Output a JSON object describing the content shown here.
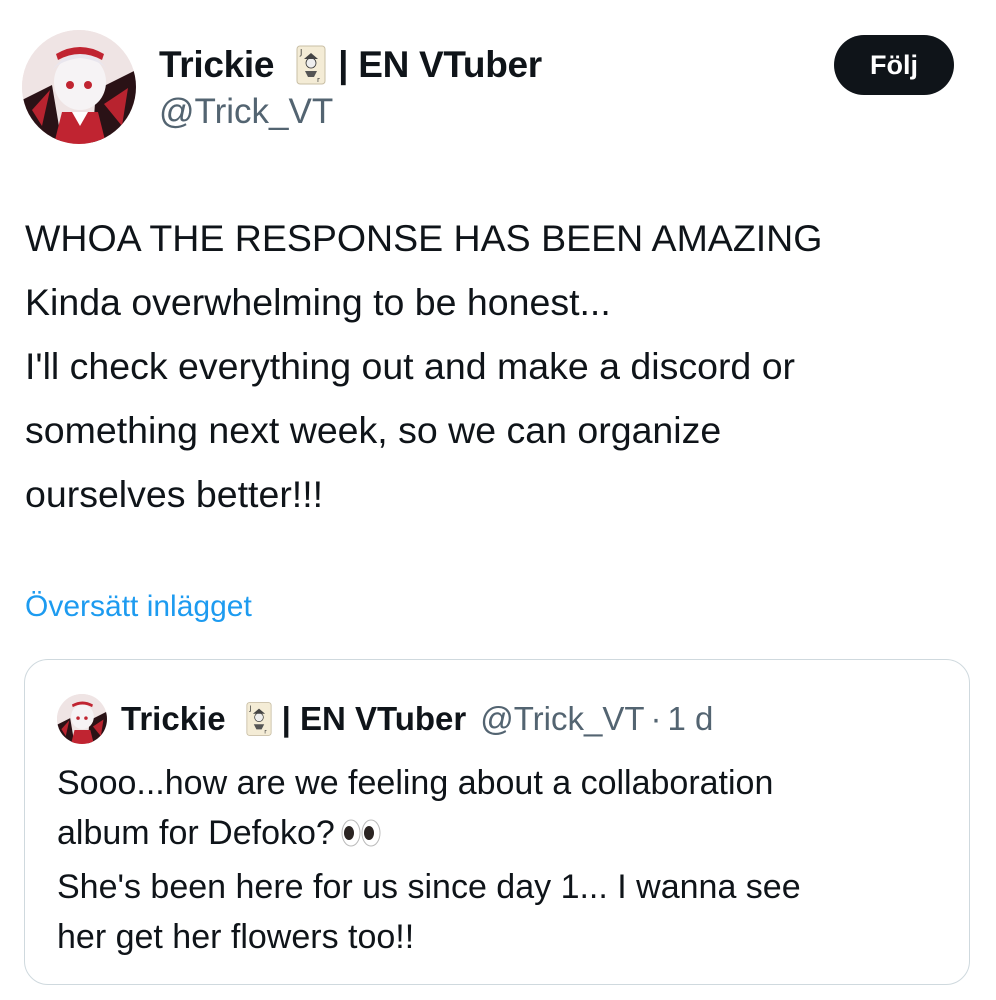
{
  "author": {
    "display_name": "Trickie",
    "name_suffix": "| EN VTuber",
    "handle": "@Trick_VT"
  },
  "follow_button": {
    "label": "Följ"
  },
  "tweet": {
    "lines": [
      "WHOA THE RESPONSE HAS BEEN AMAZING",
      "Kinda overwhelming to be honest...",
      "I'll check everything out and make a discord or",
      "something next week, so we can organize",
      "ourselves better!!!"
    ]
  },
  "translate_link": "Översätt inlägget",
  "quoted_tweet": {
    "display_name": "Trickie",
    "name_suffix": "| EN VTuber",
    "handle": "@Trick_VT",
    "separator": "·",
    "time": "1 d",
    "lines": [
      "Sooo...how are we feeling about a collaboration",
      "album for Defoko?",
      "She's been here for us since day 1... I wanna see",
      "her get her flowers too!!"
    ]
  },
  "icons": {
    "card": "joker-playing-card-icon",
    "eyes": "eyes-emoji-icon"
  },
  "colors": {
    "link": "#1d9bf0",
    "secondary_text": "#536471",
    "follow_bg": "#0f1419",
    "border": "#cfd9de"
  }
}
